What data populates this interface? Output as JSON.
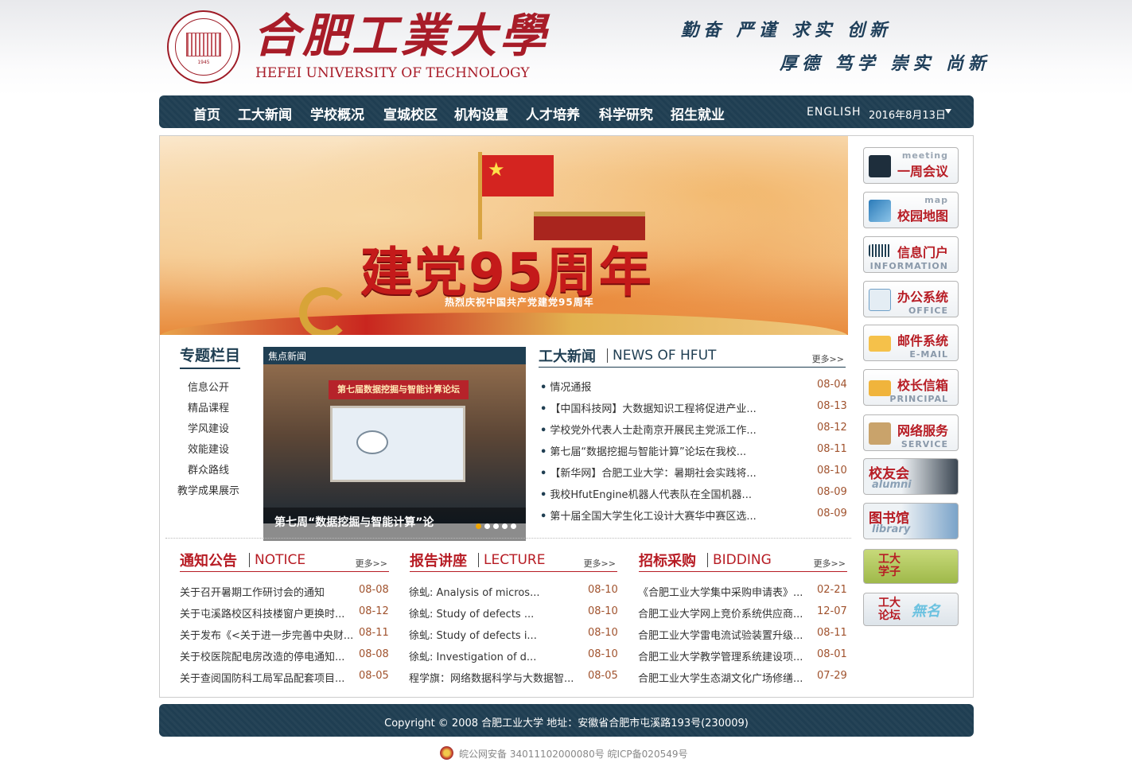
{
  "header": {
    "logo_cn": "合肥工業大學",
    "logo_en": "HEFEI UNIVERSITY OF TECHNOLOGY",
    "seal_year": "1945",
    "motto_line1": "勤奋 严谨 求实 创新",
    "motto_line2": "厚德 笃学 崇实 尚新"
  },
  "nav": {
    "items": [
      "首页",
      "工大新闻",
      "学校概况",
      "宣城校区",
      "机构设置",
      "人才培养",
      "科学研究",
      "招生就业"
    ],
    "english": "ENGLISH",
    "date": "2016年8月13日"
  },
  "banner": {
    "title": "建党95周年",
    "subtitle": "热烈庆祝中国共产党建党95周年"
  },
  "special": {
    "title": "专题栏目",
    "items": [
      "信息公开",
      "精品课程",
      "学风建设",
      "效能建设",
      "群众路线",
      "教学成果展示"
    ]
  },
  "focus": {
    "header": "焦点新闻",
    "banner_text": "第七届数据挖掘与智能计算论坛",
    "caption": "第七周“数据挖掘与智能计算”论"
  },
  "news": {
    "title_cn": "工大新闻",
    "title_en": "NEWS OF HFUT",
    "more": "更多>>",
    "rows": [
      {
        "title": "情况通报",
        "date": "08-04"
      },
      {
        "title": "【中国科技网】大数据知识工程将促进产业...",
        "date": "08-13"
      },
      {
        "title": "学校党外代表人士赴南京开展民主党派工作...",
        "date": "08-12"
      },
      {
        "title": "第七届“数据挖掘与智能计算”论坛在我校...",
        "date": "08-11"
      },
      {
        "title": "【新华网】合肥工业大学：暑期社会实践将...",
        "date": "08-10"
      },
      {
        "title": "我校HfutEngine机器人代表队在全国机器...",
        "date": "08-09"
      },
      {
        "title": "第十届全国大学生化工设计大赛华中赛区选...",
        "date": "08-09"
      }
    ]
  },
  "notice": {
    "title_cn": "通知公告",
    "title_en": "NOTICE",
    "more": "更多>>",
    "rows": [
      {
        "title": "关于召开暑期工作研讨会的通知",
        "date": "08-08"
      },
      {
        "title": "关于屯溪路校区科技楼窗户更换时...",
        "date": "08-12"
      },
      {
        "title": "关于发布《<关于进一步完善中央财...",
        "date": "08-11"
      },
      {
        "title": "关于校医院配电房改造的停电通知...",
        "date": "08-08"
      },
      {
        "title": "关于查阅国防科工局军品配套项目...",
        "date": "08-05"
      }
    ]
  },
  "lecture": {
    "title_cn": "报告讲座",
    "title_en": "LECTURE",
    "more": "更多>>",
    "rows": [
      {
        "title": "徐虬: Analysis of micros...",
        "date": "08-10"
      },
      {
        "title": "徐虬: Study of defects ...",
        "date": "08-10"
      },
      {
        "title": "徐虬: Study of defects i...",
        "date": "08-10"
      },
      {
        "title": "徐虬: Investigation of d...",
        "date": "08-10"
      },
      {
        "title": "程学旗：网络数据科学与大数据智...",
        "date": "08-05"
      }
    ]
  },
  "bidding": {
    "title_cn": "招标采购",
    "title_en": "BIDDING",
    "more": "更多>>",
    "rows": [
      {
        "title": "《合肥工业大学集中采购申请表》...",
        "date": "02-21"
      },
      {
        "title": "合肥工业大学网上竞价系统供应商...",
        "date": "12-07"
      },
      {
        "title": "合肥工业大学雷电流试验装置升级...",
        "date": "08-11"
      },
      {
        "title": "合肥工业大学教学管理系统建设项...",
        "date": "08-01"
      },
      {
        "title": "合肥工业大学生态湖文化广场修缮...",
        "date": "07-29"
      }
    ]
  },
  "sidebar": {
    "meeting": {
      "en": "meeting",
      "cn": "一周会议"
    },
    "map": {
      "en": "map",
      "cn": "校园地图"
    },
    "info": {
      "cn": "信息门户",
      "en": "INFORMATION"
    },
    "office": {
      "cn": "办公系统",
      "en": "OFFICE"
    },
    "email": {
      "cn": "邮件系统",
      "en": "E-MAIL"
    },
    "principal": {
      "cn": "校长信箱",
      "en": "PRINCIPAL"
    },
    "service": {
      "cn": "网络服务",
      "en": "SERVICE"
    },
    "alumni": {
      "cn": "校友会",
      "en": "alumni"
    },
    "library": {
      "cn": "图书馆",
      "en": "library"
    },
    "students": {
      "cn": "工大学子"
    },
    "forum": {
      "cn": "工大论坛",
      "en": "無名"
    }
  },
  "footer": {
    "copyright": "Copyright © 2008 合肥工业大学  地址：安徽省合肥市屯溪路193号(230009)",
    "beian": "皖公网安备 34011102000080号  皖ICP备020549号"
  },
  "colors": {
    "brand_red": "#a81c28",
    "nav_blue": "#1f3e52",
    "date_brown": "#a0522d"
  }
}
